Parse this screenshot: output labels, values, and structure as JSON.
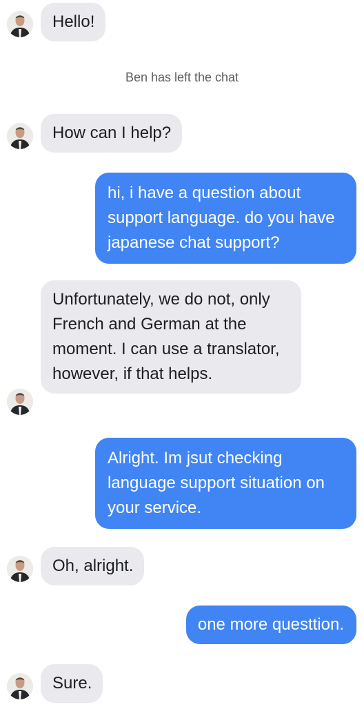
{
  "chat": {
    "messages": [
      {
        "from": "agent",
        "text": "Hello!"
      },
      {
        "from": "system",
        "text": "Ben has left the chat"
      },
      {
        "from": "agent",
        "text": "How can I help?"
      },
      {
        "from": "user",
        "text": "hi, i have a question about support language. do you have japanese chat support?"
      },
      {
        "from": "agent",
        "text": "Unfortunately, we do not, only French and German at the moment. I can use a translator, however, if that helps."
      },
      {
        "from": "user",
        "text": "Alright. Im jsut checking language support situation on your service."
      },
      {
        "from": "agent",
        "text": "Oh, alright."
      },
      {
        "from": "user",
        "text": "one more questtion."
      },
      {
        "from": "agent",
        "text": "Sure."
      }
    ],
    "avatar_icon": "agent-avatar",
    "colors": {
      "user_bubble": "#4185f4",
      "agent_bubble": "#e9e9ee",
      "system_text": "#5d5d5d"
    }
  }
}
